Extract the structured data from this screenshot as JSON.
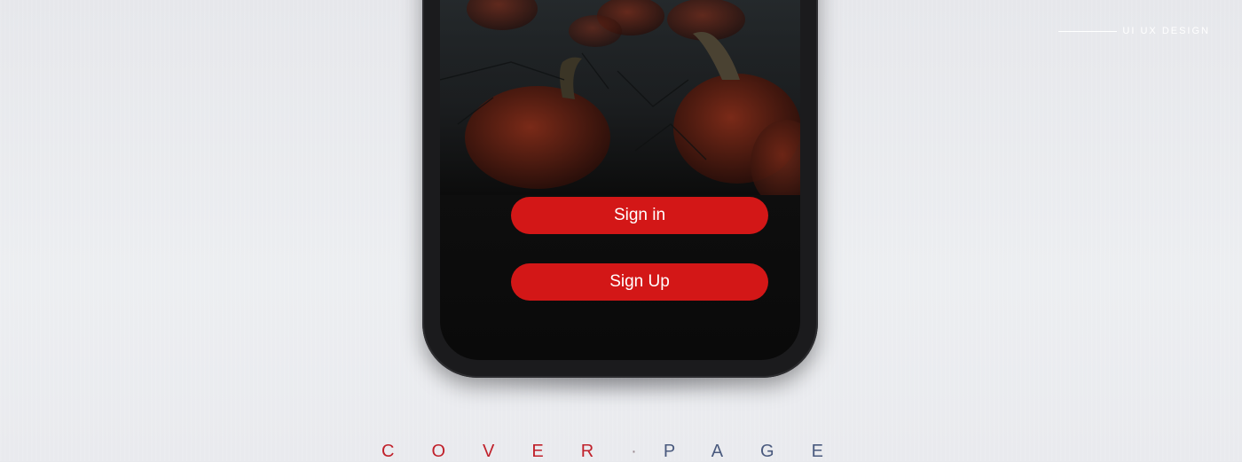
{
  "header": {
    "tagline": "UI UX DESIGN"
  },
  "screen": {
    "buttons": {
      "sign_in": "Sign in",
      "sign_up": "Sign Up"
    }
  },
  "footer": {
    "word1": "COVER",
    "separator": "·",
    "word2": "PAGE"
  },
  "colors": {
    "accent": "#d31717",
    "background": "#e8e9ed",
    "footer_red": "#c0202a",
    "footer_blue": "#4a5a7e"
  }
}
